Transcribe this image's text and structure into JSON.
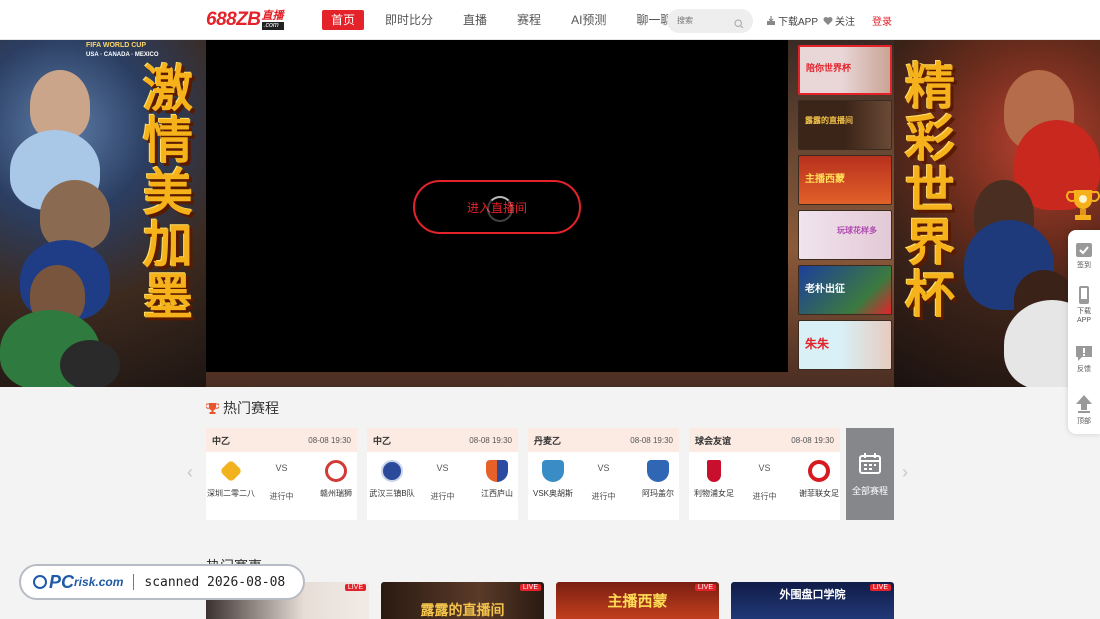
{
  "header": {
    "logo_main": "688ZB",
    "logo_zh": "直播",
    "logo_com": ".com",
    "nav": [
      "首页",
      "即时比分",
      "直播",
      "赛程",
      "AI预测",
      "聊一聊"
    ],
    "search_placeholder": "搜索",
    "download": "下载APP",
    "follow": "关注",
    "login": "登录"
  },
  "hero": {
    "left_slogan": "激情美加墨",
    "right_slogan": "精彩世界杯",
    "wc_title": "FIFA WORLD CUP",
    "wc_hosts": "USA · CANADA · MEXICO",
    "enter_button": "进入直播间",
    "thumbs": [
      {
        "text": "陪你世界杯",
        "bg": "#e9d7d8",
        "color": "#e3222a"
      },
      {
        "text": "露露的直播间",
        "bg": "#3b2418",
        "color": "#f3c34a"
      },
      {
        "text": "主播西蒙",
        "bg": "#c8331f",
        "color": "#ffdd55"
      },
      {
        "text": "玩球花样多",
        "bg": "#f4e6f1",
        "color": "#b04ab0"
      },
      {
        "text": "老朴出征",
        "bg": "#1d3f9a",
        "color": "#ffffff"
      },
      {
        "text": "朱朱",
        "bg": "#cfeaf2",
        "color": "#e3222a"
      }
    ]
  },
  "sidebar": {
    "items": [
      "签到",
      "下载APP",
      "反馈",
      "顶部"
    ]
  },
  "hot_schedule": {
    "title": "热门赛程",
    "all_label": "全部赛程",
    "matches": [
      {
        "league": "中乙",
        "time": "08-08 19:30",
        "home": "深圳二零二八",
        "away": "赣州瑞狮",
        "vs": "VS",
        "status": "进行中",
        "home_color": "#f1b21d",
        "away_color": "#d23a36"
      },
      {
        "league": "中乙",
        "time": "08-08 19:30",
        "home": "武汉三镇B队",
        "away": "江西庐山",
        "vs": "VS",
        "status": "进行中",
        "home_color": "#2c4a9a",
        "away_color": "#e6602a"
      },
      {
        "league": "丹麦乙",
        "time": "08-08 19:30",
        "home": "VSK奥胡斯",
        "away": "阿玛盖尔",
        "vs": "VS",
        "status": "进行中",
        "home_color": "#3a8cc6",
        "away_color": "#2f67b5"
      },
      {
        "league": "球会友谊",
        "time": "08-08 19:30",
        "home": "利物浦女足",
        "away": "谢菲联女足",
        "vs": "VS",
        "status": "进行中",
        "home_color": "#c8102e",
        "away_color": "#d71920"
      }
    ]
  },
  "hot_matches": {
    "title": "热门赛事",
    "live_label": "LIVE",
    "cards": [
      {
        "caption": "",
        "bg": "#e7ddd6"
      },
      {
        "caption": "露露的直播间",
        "bg": "#2a1a12"
      },
      {
        "caption": "主播西蒙",
        "bg": "#a82b1c"
      },
      {
        "caption": "外围盘口学院",
        "bg": "#16275a"
      }
    ]
  },
  "watermark": {
    "brand_pc": "PC",
    "brand_rest": "risk.com",
    "scanned": "scanned 2026-08-08"
  }
}
